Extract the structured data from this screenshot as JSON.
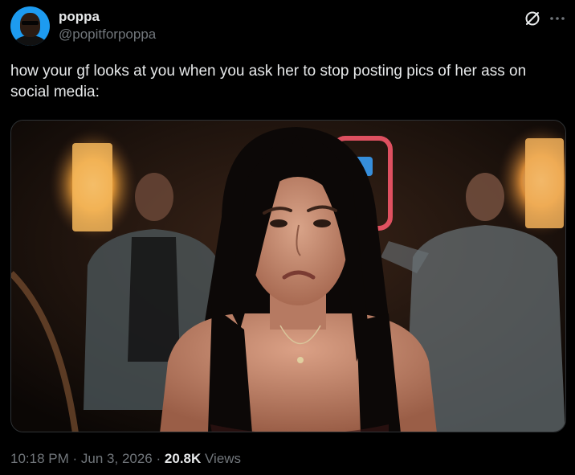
{
  "author": {
    "display_name": "poppa",
    "handle": "@popitforpoppa",
    "avatar_icon": "person-avatar"
  },
  "actions": {
    "grok_icon": "grok-slash-circle-icon",
    "more_icon": "more-dots-icon"
  },
  "tweet": {
    "text": "how your gf looks at you when you ask her to stop posting pics of her ass on social media:",
    "media_description_icon": "video-still-image"
  },
  "meta": {
    "time": "10:18 PM",
    "separator1": "·",
    "date": "Jun 3, 2026",
    "separator2": "·",
    "views_count": "20.8K",
    "views_label": "Views"
  },
  "colors": {
    "background": "#000000",
    "primary_text": "#e7e9ea",
    "secondary_text": "#71767b",
    "avatar_bg": "#1d9bf0",
    "border": "#2f3336"
  }
}
